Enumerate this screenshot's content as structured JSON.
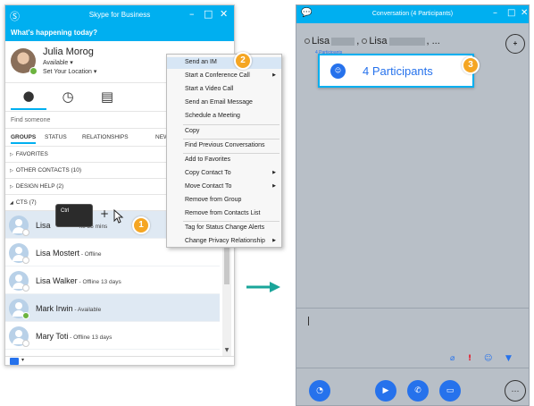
{
  "skype": {
    "title": "Skype for Business",
    "happening": "What's happening today?",
    "user_name": "Julia Morog",
    "user_status": "Available ▾",
    "user_location": "Set Your Location ▾",
    "search_placeholder": "Find someone",
    "filters": [
      "GROUPS",
      "STATUS",
      "RELATIONSHIPS",
      "NEW"
    ],
    "groups": [
      {
        "label": "FAVORITES"
      },
      {
        "label": "OTHER CONTACTS (10)"
      },
      {
        "label": "DESIGN HELP (2)"
      },
      {
        "label": "CTS (7)"
      }
    ],
    "contacts": [
      {
        "name": "Lisa",
        "status": "ne 35 mins",
        "presence": "offline"
      },
      {
        "name": "Lisa Mostert",
        "status": " - Offline",
        "presence": "offline"
      },
      {
        "name": "Lisa Walker",
        "status": " - Offline 13 days",
        "presence": "offline"
      },
      {
        "name": "Mark Irwin",
        "status": " - Available",
        "presence": "available"
      },
      {
        "name": "Mary Toti",
        "status": " - Offline 13 days",
        "presence": "offline"
      }
    ],
    "ctrl_label": "Ctrl",
    "plus": "+"
  },
  "context_menu": {
    "items": [
      "Send an IM",
      "Start a Conference Call",
      "Start a Video Call",
      "Send an Email Message",
      "Schedule a Meeting",
      "Copy",
      "Find Previous Conversations",
      "Add to Favorites",
      "Copy Contact To",
      "Move Contact To",
      "Remove from Group",
      "Remove from Contacts List",
      "Tag for Status Change Alerts",
      "Change Privacy Relationship"
    ]
  },
  "badges": [
    "1",
    "2",
    "3"
  ],
  "conversation": {
    "title": "Conversation (4 Participants)",
    "participants_line_a": "Lisa",
    "participants_line_b": "Lisa",
    "participants_tail": ", ...",
    "participants_sub": "4 Participants",
    "participants_label": "4 Participants"
  },
  "icons": {
    "skype_logo": "skype-logo-icon",
    "contacts_tab": "person-icon",
    "history_tab": "clock-icon",
    "meetings_tab": "calendar-icon",
    "add_participant": "add-person-icon",
    "participants": "people-icon",
    "im": "chat-icon",
    "video": "video-icon",
    "call": "phone-icon",
    "present": "monitor-icon",
    "more": "ellipsis-icon"
  },
  "colors": {
    "brand": "#00aff0",
    "accent": "#2672ec",
    "badge": "#f5a623",
    "available": "#6cb33f",
    "important": "#e81123",
    "arrow": "#1aa59a"
  }
}
